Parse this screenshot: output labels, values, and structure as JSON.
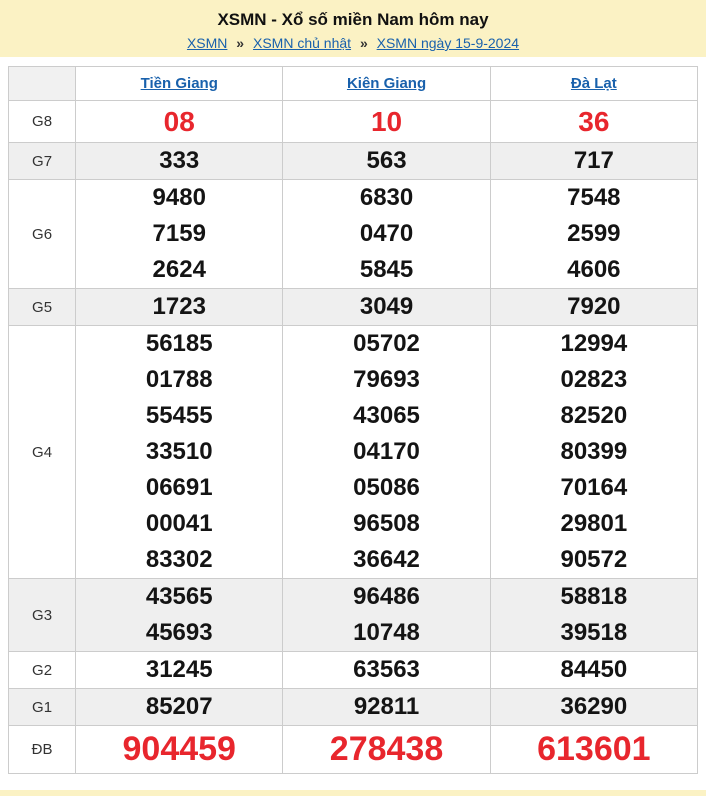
{
  "header": {
    "title": "XSMN - Xổ số miền Nam hôm nay",
    "separator": "»",
    "breadcrumb": [
      "XSMN",
      "XSMN chủ nhật",
      "XSMN ngày 15-9-2024"
    ]
  },
  "table": {
    "columns": [
      "Tiền Giang",
      "Kiên Giang",
      "Đà Lạt"
    ],
    "prizes": [
      {
        "label": "G8",
        "values": [
          [
            "08"
          ],
          [
            "10"
          ],
          [
            "36"
          ]
        ]
      },
      {
        "label": "G7",
        "values": [
          [
            "333"
          ],
          [
            "563"
          ],
          [
            "717"
          ]
        ]
      },
      {
        "label": "G6",
        "values": [
          [
            "9480",
            "7159",
            "2624"
          ],
          [
            "6830",
            "0470",
            "5845"
          ],
          [
            "7548",
            "2599",
            "4606"
          ]
        ]
      },
      {
        "label": "G5",
        "values": [
          [
            "1723"
          ],
          [
            "3049"
          ],
          [
            "7920"
          ]
        ]
      },
      {
        "label": "G4",
        "values": [
          [
            "56185",
            "01788",
            "55455",
            "33510",
            "06691",
            "00041",
            "83302"
          ],
          [
            "05702",
            "79693",
            "43065",
            "04170",
            "05086",
            "96508",
            "36642"
          ],
          [
            "12994",
            "02823",
            "82520",
            "80399",
            "70164",
            "29801",
            "90572"
          ]
        ]
      },
      {
        "label": "G3",
        "values": [
          [
            "43565",
            "45693"
          ],
          [
            "96486",
            "10748"
          ],
          [
            "58818",
            "39518"
          ]
        ]
      },
      {
        "label": "G2",
        "values": [
          [
            "31245"
          ],
          [
            "63563"
          ],
          [
            "84450"
          ]
        ]
      },
      {
        "label": "G1",
        "values": [
          [
            "85207"
          ],
          [
            "92811"
          ],
          [
            "36290"
          ]
        ]
      },
      {
        "label": "ĐB",
        "values": [
          [
            "904459"
          ],
          [
            "278438"
          ],
          [
            "613601"
          ]
        ]
      }
    ]
  },
  "colors": {
    "banner_bg": "#fbf2c4",
    "link_blue": "#1961ac",
    "number_red": "#e8262d",
    "row_alt_bg": "#efefef",
    "border": "#cccccc"
  }
}
